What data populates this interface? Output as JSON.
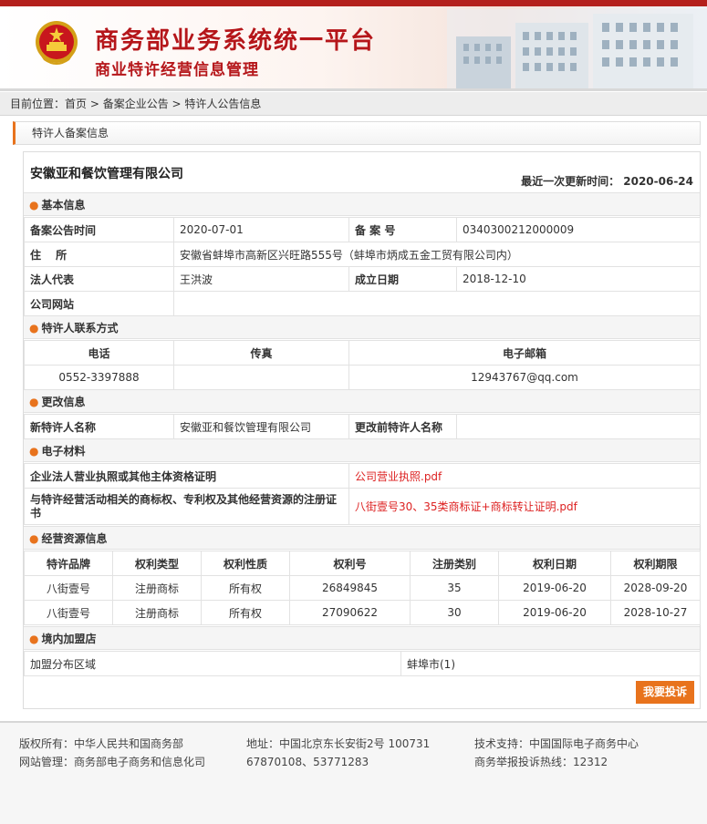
{
  "header": {
    "title_main": "商务部业务系统统一平台",
    "title_sub": "商业特许经营信息管理",
    "brand_red": "#b5161a"
  },
  "breadcrumb": {
    "prefix": "目前位置：",
    "items": [
      "首页",
      "备案企业公告",
      "特许人公告信息"
    ],
    "sep": " > "
  },
  "section_title": "特许人备案信息",
  "company_name": "安徽亚和餐饮管理有限公司",
  "update_text": "最近一次更新时间： 2020-06-24",
  "basic": {
    "heading": "基本信息",
    "filing_time_label": "备案公告时间",
    "filing_time": "2020-07-01",
    "filing_no_label": "备 案 号",
    "filing_no": "0340300212000009",
    "address_label": "住　 所",
    "address": "安徽省蚌埠市高新区兴旺路555号（蚌埠市炳成五金工贸有限公司内）",
    "legal_rep_label": "法人代表",
    "legal_rep": "王洪波",
    "founded_label": "成立日期",
    "founded": "2018-12-10",
    "website_label": "公司网站",
    "website": ""
  },
  "contact": {
    "heading": "特许人联系方式",
    "phone_label": "电话",
    "fax_label": "传真",
    "email_label": "电子邮箱",
    "phone": "0552-3397888",
    "fax": "",
    "email": "12943767@qq.com"
  },
  "change": {
    "heading": "更改信息",
    "new_name_label": "新特许人名称",
    "new_name": "安徽亚和餐饮管理有限公司",
    "old_name_label": "更改前特许人名称",
    "old_name": ""
  },
  "materials": {
    "heading": "电子材料",
    "license_label": "企业法人营业执照或其他主体资格证明",
    "license_file": "公司营业执照.pdf",
    "trademark_label": "与特许经营活动相关的商标权、专利权及其他经营资源的注册证书",
    "trademark_file": "八街壹号30、35类商标证+商标转让证明.pdf"
  },
  "resources": {
    "heading": "经营资源信息",
    "columns": [
      "特许品牌",
      "权利类型",
      "权利性质",
      "权利号",
      "注册类别",
      "权利日期",
      "权利期限"
    ],
    "rows": [
      [
        "八街壹号",
        "注册商标",
        "所有权",
        "26849845",
        "35",
        "2019-06-20",
        "2028-09-20"
      ],
      [
        "八街壹号",
        "注册商标",
        "所有权",
        "27090622",
        "30",
        "2019-06-20",
        "2028-10-27"
      ]
    ]
  },
  "stores": {
    "heading": "境内加盟店",
    "area_label": "加盟分布区域",
    "area_value": "蚌埠市(1)"
  },
  "complaint_button": "我要投诉",
  "footer": {
    "copyright": "版权所有：中华人民共和国商务部",
    "manage": "网站管理：商务部电子商务和信息化司",
    "address": "地址：中国北京东长安街2号 100731",
    "phones": "67870108、53771283",
    "support": "技术支持：中国国际电子商务中心",
    "hotline": "商务举报投诉热线：12312"
  }
}
